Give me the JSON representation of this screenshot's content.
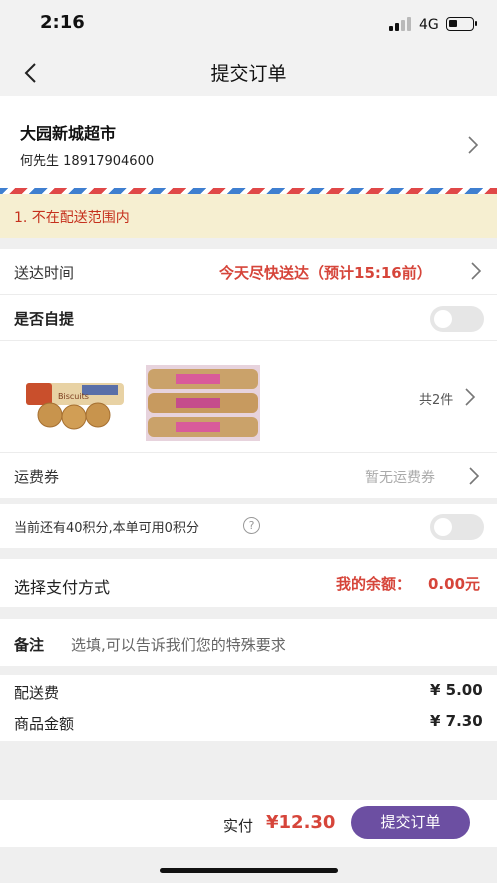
{
  "status_bar": {
    "time": "2:16",
    "network": "4G"
  },
  "nav": {
    "title": "提交订单"
  },
  "address": {
    "name": "大园新城超市",
    "contact": "何先生 18917904600"
  },
  "warning": {
    "text": "1. 不在配送范围内"
  },
  "delivery_time": {
    "label": "送达时间",
    "value": "今天尽快送达（预计15:16前）"
  },
  "self_pickup": {
    "label": "是否自提",
    "enabled": false
  },
  "products": {
    "count_label": "共2件"
  },
  "shipping_coupon": {
    "label": "运费券",
    "value": "暂无运费券"
  },
  "points": {
    "label": "当前还有40积分,本单可用0积分",
    "help_icon": "?",
    "enabled": false
  },
  "payment": {
    "label": "选择支付方式",
    "balance_label": "我的余额：",
    "balance_value": "0.00元"
  },
  "remark": {
    "label": "备注",
    "placeholder": "选填,可以告诉我们您的特殊要求"
  },
  "fees": {
    "delivery_label": "配送费",
    "delivery_value": "¥ 5.00",
    "goods_label": "商品金额",
    "goods_value": "¥ 7.30"
  },
  "footer": {
    "total_label": "实付",
    "total_amount": "¥12.30",
    "submit_label": "提交订单"
  },
  "colors": {
    "accent": "#6c4fa2",
    "price_red": "#d6453a",
    "warning_bg": "#f6efd1"
  }
}
